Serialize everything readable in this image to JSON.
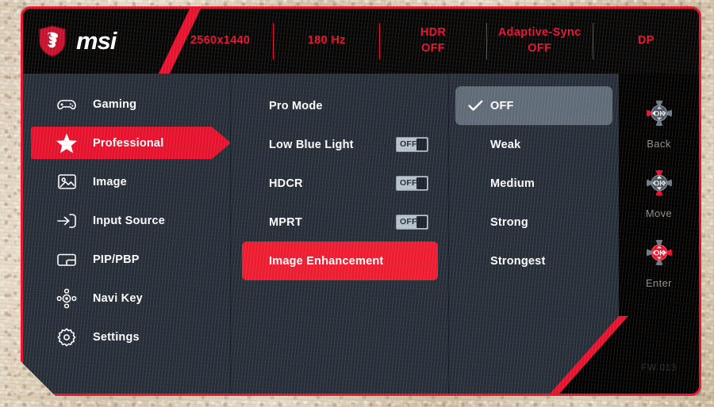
{
  "brand": {
    "logo_icon": "msi-dragon-shield-icon",
    "wordmark": "msi"
  },
  "header": {
    "status": [
      {
        "line1": "2560x1440",
        "line2": ""
      },
      {
        "line1": "180 Hz",
        "line2": ""
      },
      {
        "line1": "HDR",
        "line2": "OFF"
      },
      {
        "line1": "Adaptive-Sync",
        "line2": "OFF"
      },
      {
        "line1": "DP",
        "line2": ""
      }
    ]
  },
  "sidebar": {
    "items": [
      {
        "label": "Gaming",
        "icon": "gamepad-icon",
        "active": false
      },
      {
        "label": "Professional",
        "icon": "star-icon",
        "active": true
      },
      {
        "label": "Image",
        "icon": "picture-icon",
        "active": false
      },
      {
        "label": "Input Source",
        "icon": "input-arrow-icon",
        "active": false
      },
      {
        "label": "PIP/PBP",
        "icon": "pip-pbp-icon",
        "active": false
      },
      {
        "label": "Navi Key",
        "icon": "navi-key-icon",
        "active": false
      },
      {
        "label": "Settings",
        "icon": "gear-icon",
        "active": false
      }
    ]
  },
  "submenu": {
    "items": [
      {
        "label": "Pro Mode",
        "toggle": null,
        "highlight": false
      },
      {
        "label": "Low Blue Light",
        "toggle": "OFF",
        "highlight": false
      },
      {
        "label": "HDCR",
        "toggle": "OFF",
        "highlight": false
      },
      {
        "label": "MPRT",
        "toggle": "OFF",
        "highlight": false
      },
      {
        "label": "Image Enhancement",
        "toggle": null,
        "highlight": true
      }
    ]
  },
  "options": {
    "items": [
      {
        "label": "OFF",
        "selected": true
      },
      {
        "label": "Weak",
        "selected": false
      },
      {
        "label": "Medium",
        "selected": false
      },
      {
        "label": "Strong",
        "selected": false
      },
      {
        "label": "Strongest",
        "selected": false
      }
    ],
    "check_icon": "checkmark-icon"
  },
  "navkeys": {
    "items": [
      {
        "label": "Back",
        "icon": "dpad-left-icon"
      },
      {
        "label": "Move",
        "icon": "dpad-updown-icon"
      },
      {
        "label": "Enter",
        "icon": "dpad-ok-right-icon"
      }
    ],
    "firmware": "FW 013"
  },
  "colors": {
    "accent_red": "#e8112d",
    "panel": "#242d38",
    "selected_gray": "#5f6b79",
    "text": "#ffffff"
  }
}
